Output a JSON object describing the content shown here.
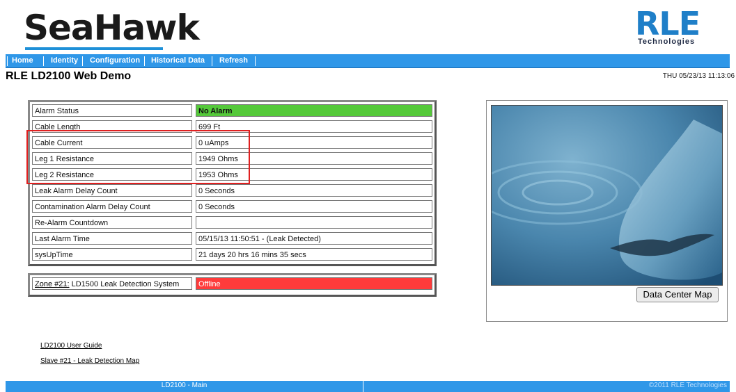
{
  "header": {
    "seahawk_logo": "SeaHawk",
    "rle_logo": "RLE",
    "rle_tagline": "Technologies"
  },
  "nav": {
    "items": [
      "Home",
      "Identity",
      "Configuration",
      "Historical Data",
      "Refresh"
    ]
  },
  "page": {
    "title": "RLE LD2100 Web Demo",
    "datetime": "THU 05/23/13 11:13:06"
  },
  "status": {
    "rows": [
      {
        "label": "Alarm Status",
        "value": "No Alarm"
      },
      {
        "label": "Cable Length",
        "value": "699 Ft"
      },
      {
        "label": "Cable Current",
        "value": "0 uAmps"
      },
      {
        "label": "Leg 1 Resistance",
        "value": "1949 Ohms"
      },
      {
        "label": "Leg 2 Resistance",
        "value": "1953 Ohms"
      },
      {
        "label": "Leak Alarm Delay Count",
        "value": "0 Seconds"
      },
      {
        "label": "Contamination Alarm Delay Count",
        "value": "0 Seconds"
      },
      {
        "label": "Re-Alarm Countdown",
        "value": ""
      },
      {
        "label": "Last Alarm Time",
        "value": "05/15/13 11:50:51  -  (Leak Detected)"
      },
      {
        "label": "sysUpTime",
        "value": "21 days 20 hrs 16 mins 35 secs"
      }
    ]
  },
  "zone": {
    "link": "Zone #21:",
    "description": " LD1500 Leak Detection System",
    "status": "Offline"
  },
  "image_panel": {
    "button_label": "Data Center Map"
  },
  "links": {
    "user_guide": "LD2100 User Guide",
    "leak_map": "Slave #21 - Leak Detection Map"
  },
  "footer": {
    "left": "LD2100 - Main",
    "right": "©2011 RLE Technologies"
  },
  "colors": {
    "nav": "#2f97e8",
    "ok": "#55c93a",
    "alarm": "#ff3b3b",
    "highlight": "#e02020"
  }
}
